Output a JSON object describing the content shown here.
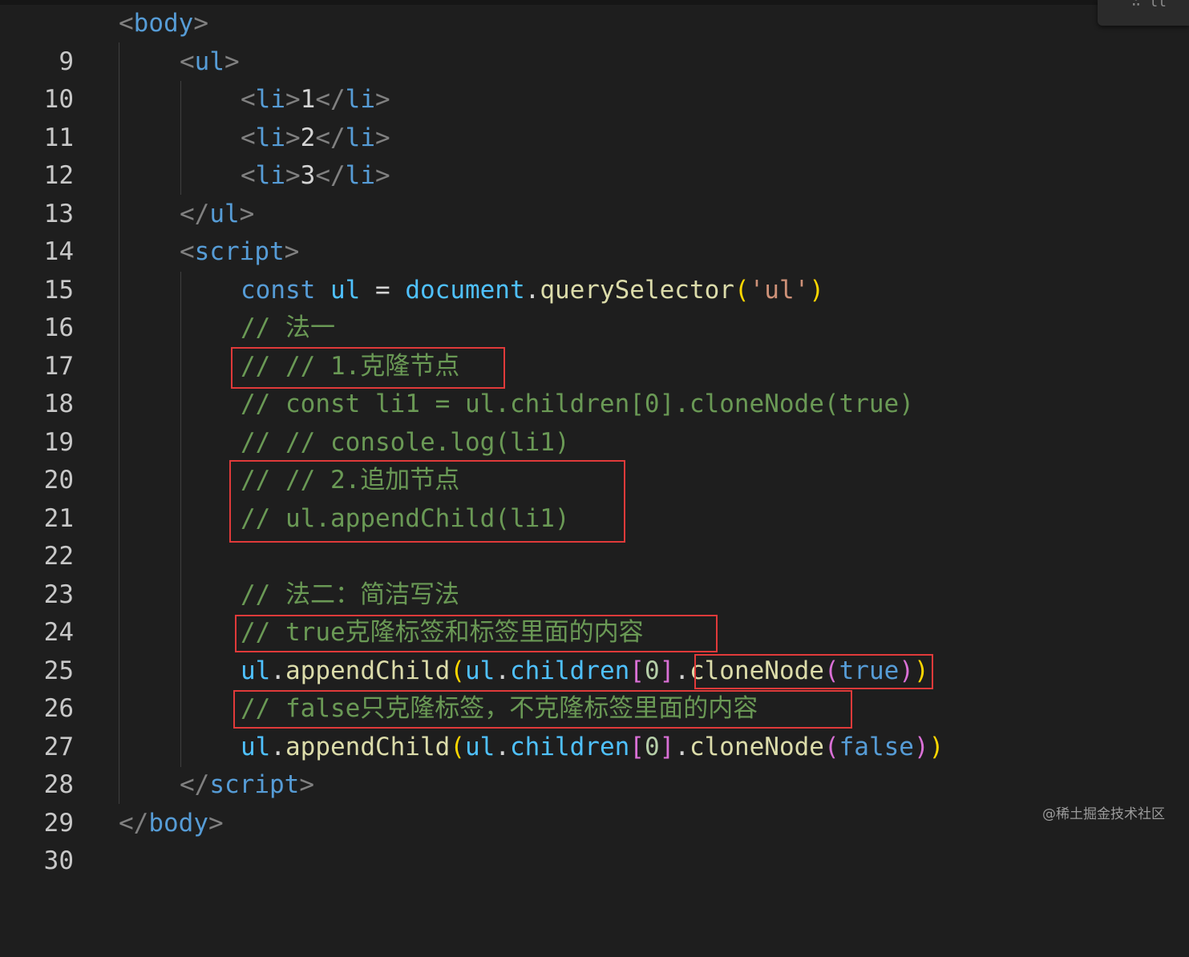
{
  "editor": {
    "minimap_glyph": "∴ ll",
    "lines": [
      {
        "n": "9"
      },
      {
        "n": "10"
      },
      {
        "n": "11"
      },
      {
        "n": "12"
      },
      {
        "n": "13"
      },
      {
        "n": "14"
      },
      {
        "n": "15"
      },
      {
        "n": "16"
      },
      {
        "n": "17"
      },
      {
        "n": "18"
      },
      {
        "n": "19"
      },
      {
        "n": "20"
      },
      {
        "n": "21"
      },
      {
        "n": "22"
      },
      {
        "n": "23"
      },
      {
        "n": "24"
      },
      {
        "n": "25"
      },
      {
        "n": "26"
      },
      {
        "n": "27"
      },
      {
        "n": "28"
      },
      {
        "n": "29"
      },
      {
        "n": "30"
      }
    ],
    "tokens": {
      "lt": "<",
      "gt": ">",
      "ltslash": "</",
      "body": "body",
      "ul": "ul",
      "li": "li",
      "script": "script",
      "one": "1",
      "two": "2",
      "three": "3",
      "const": "const",
      "ul_var": "ul",
      "eq": " = ",
      "document": "document",
      "dot": ".",
      "querySelector": "querySelector",
      "lp": "(",
      "rp": ")",
      "str_ul": "'ul'",
      "c17": "// 法一",
      "c18": "// // 1.克隆节点",
      "c19": "// const li1 = ul.children[0].cloneNode(true)",
      "c20": "// // console.log(li1)",
      "c21": "// // 2.追加节点",
      "c22": "// ul.appendChild(li1)",
      "c24": "// 法二：简洁写法",
      "c25": "// true克隆标签和标签里面的内容",
      "c27": "// false只克隆标签，不克隆标签里面的内容",
      "appendChild": "appendChild",
      "children": "children",
      "lb": "[",
      "rb": "]",
      "zero": "0",
      "cloneNode": "cloneNode",
      "true_kw": "true",
      "false_kw": "false"
    }
  },
  "watermark": "@稀土掘金技术社区",
  "colors": {
    "background": "#1e1e1e",
    "annotation_box": "#e03a3a",
    "comment": "#6a9955",
    "keyword": "#569cd6",
    "variable": "#4fc1ff",
    "function": "#dcdcaa"
  }
}
